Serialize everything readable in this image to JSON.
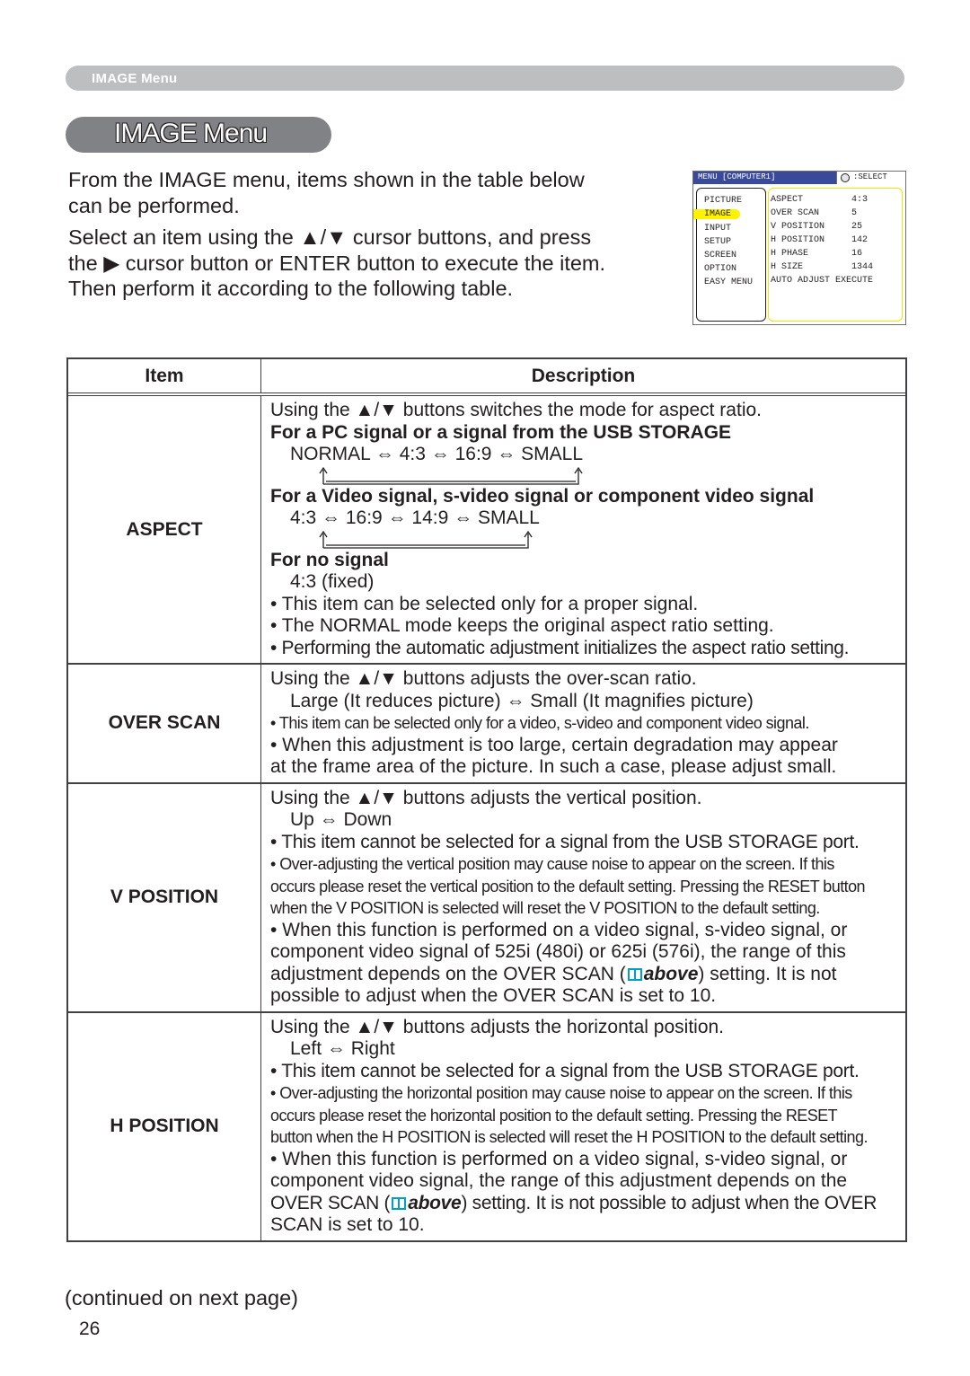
{
  "header": {
    "section_label": "IMAGE Menu"
  },
  "title": "IMAGE Menu",
  "intro": {
    "para1_line1": "From the IMAGE menu, items shown in the table below",
    "para1_line2": "can be performed.",
    "para2_line1": "Select an item using the ▲/▼ cursor buttons, and press",
    "para2_line2": "the ▶ cursor button or ENTER button to execute the item.",
    "para2_line3": "Then perform it according to the following table."
  },
  "osd": {
    "title": "MENU [COMPUTER1]",
    "select_label": ":SELECT",
    "select_icon": "dial-icon",
    "menu_items": [
      "PICTURE",
      "IMAGE",
      "INPUT",
      "SETUP",
      "SCREEN",
      "OPTION",
      "EASY MENU"
    ],
    "selected_item": "IMAGE",
    "settings": [
      {
        "name": "ASPECT",
        "value": "4:3"
      },
      {
        "name": "OVER SCAN",
        "value": "5"
      },
      {
        "name": "V POSITION",
        "value": "25"
      },
      {
        "name": "H POSITION",
        "value": "142"
      },
      {
        "name": "H PHASE",
        "value": "16"
      },
      {
        "name": "H SIZE",
        "value": "1344"
      },
      {
        "name": "AUTO ADJUST EXECUTE",
        "value": ""
      }
    ],
    "colors": {
      "title_bar": "#3a4a9a",
      "highlight": "#fff200"
    }
  },
  "table": {
    "headers": {
      "item": "Item",
      "description": "Description"
    },
    "rows": [
      {
        "item": "ASPECT",
        "lines": {
          "l1": "Using the ▲/▼ buttons switches the mode for aspect ratio.",
          "h1": "For a PC signal or a signal from the USB STORAGE",
          "c1": "NORMAL ⇔ 4:3 ⇔ 16:9 ⇔ SMALL",
          "h2": "For a Video signal, s-video signal or component video signal",
          "c2": "4:3 ⇔ 16:9 ⇔ 14:9 ⇔ SMALL",
          "h3": "For no signal",
          "c3": "4:3 (fixed)",
          "b1": "• This item can be selected only for a proper signal.",
          "b2": "• The NORMAL mode keeps the original aspect ratio setting.",
          "b3": "• Performing the automatic adjustment initializes the aspect ratio setting."
        }
      },
      {
        "item": "OVER SCAN",
        "lines": {
          "l1": "Using the ▲/▼ buttons adjusts the over-scan ratio.",
          "c1": "Large (It reduces picture) ⇔ Small (It magnifies picture)",
          "b1": "• This item can be selected only for a video, s-video and component video signal.",
          "b2": "• When this adjustment is too large, certain degradation may appear",
          "b2b": "at the frame area of the picture. In such a case, please adjust small."
        }
      },
      {
        "item": "V POSITION",
        "lines": {
          "l1": "Using the ▲/▼ buttons adjusts the vertical position.",
          "c1": "Up ⇔ Down",
          "b1": "• This item cannot be selected for a signal from the USB STORAGE port.",
          "b2a": "• Over-adjusting the vertical position may cause noise to appear on the screen. If this",
          "b2b": "occurs please reset the vertical position to the default setting. Pressing the RESET button",
          "b2c": "when the V POSITION is selected will reset the V POSITION to the default setting.",
          "b3a": "• When this function is performed on a video signal, s-video signal, or",
          "b3b": "component video signal of 525i (480i) or 625i (576i), the range of this",
          "b3c_pre": "adjustment depends on the OVER SCAN (",
          "b3c_ref": "above",
          "b3c_post": ") setting. It is not",
          "b3d": "possible to adjust when the OVER SCAN is set to 10."
        }
      },
      {
        "item": "H POSITION",
        "lines": {
          "l1": "Using the ▲/▼ buttons adjusts the horizontal position.",
          "c1": "Left ⇔ Right",
          "b1": "• This item cannot be selected for a signal from the USB STORAGE port.",
          "b2a": "• Over-adjusting the horizontal position may cause noise to appear on the screen. If this",
          "b2b": "occurs please reset the horizontal position to the default setting. Pressing the RESET",
          "b2c": "button when the H POSITION is selected will reset the H POSITION to the default setting.",
          "b3a": "• When this function is performed on a video signal, s-video signal, or",
          "b3b": "component video signal, the range of this adjustment depends on the",
          "b3c_pre": "OVER SCAN (",
          "b3c_ref": "above",
          "b3c_post": ") setting. It is not possible to adjust when the OVER",
          "b3d": "SCAN is set to 10."
        }
      }
    ]
  },
  "footer": {
    "continued": "(continued on next page)",
    "page_number": "26"
  },
  "colors": {
    "reference_icon": "#00a0c6",
    "header_strip": "#bcbec0",
    "title_pill": "#808285"
  }
}
